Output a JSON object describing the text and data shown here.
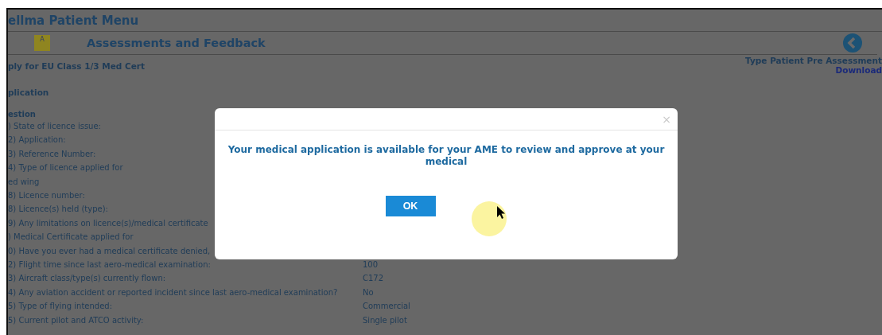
{
  "header": {
    "title": "ellma Patient Menu"
  },
  "section": {
    "badge": "A",
    "title": "Assessments and Feedback"
  },
  "form": {
    "title": "ply for EU Class 1/3 Med Cert",
    "subtitle": "plication",
    "type_label": "Type Patient Pre Assessment",
    "download_link": "Download"
  },
  "questions": {
    "heading": "estion",
    "rows": [
      {
        "question": ") State of licence issue:"
      },
      {
        "question": "2) Application:"
      },
      {
        "question": "3) Reference Number:"
      },
      {
        "question": "4) Type of licence applied for"
      },
      {
        "question": "ed wing"
      },
      {
        "question": "8) Licence number:"
      },
      {
        "question": "8) Licence(s) held (type):"
      },
      {
        "question": "9) Any limitations on licence(s)/medical certificate"
      },
      {
        "question": ") Medical Certificate applied for"
      },
      {
        "question": "0) Have you ever had a medical certificate denied,"
      },
      {
        "question": "2) Flight time since last aero-medical examination:",
        "answer": "100"
      },
      {
        "question": "3) Aircraft class/type(s) currently flown:",
        "answer": "C172"
      },
      {
        "question": "4) Any aviation accident or reported incident since last aero-medical examination?",
        "answer": "No"
      },
      {
        "question": "5) Type of flying intended:",
        "answer": "Commercial"
      },
      {
        "question": "5) Current pilot and ATCO activity:",
        "answer": "Single pilot"
      }
    ]
  },
  "dialog": {
    "close": "×",
    "message": "Your medical application is available for your AME to review and approve at your medical",
    "ok_button": "OK"
  }
}
